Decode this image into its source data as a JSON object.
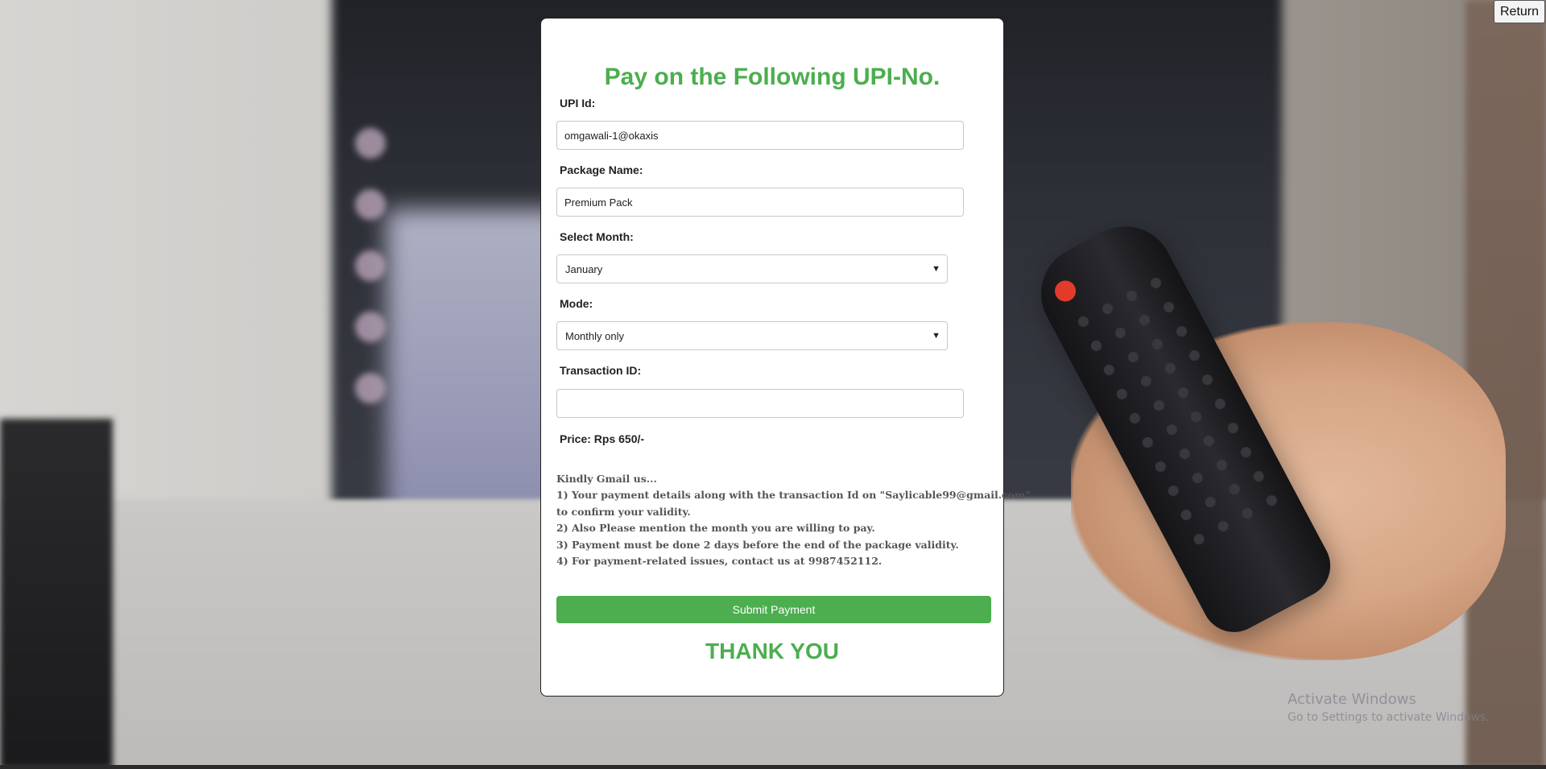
{
  "page": {
    "return_label": "Return"
  },
  "form": {
    "title": "Pay on the Following UPI-No.",
    "upi": {
      "label": "UPI Id:",
      "value": "omgawali-1@okaxis"
    },
    "package": {
      "label": "Package Name:",
      "value": "Premium Pack"
    },
    "month": {
      "label": "Select Month:",
      "selected": "January"
    },
    "mode": {
      "label": "Mode:",
      "selected": "Monthly only"
    },
    "transaction": {
      "label": "Transaction ID:",
      "value": ""
    },
    "price": "Price: Rps 650/-",
    "notes": [
      "Kindly Gmail us...",
      "1) Your payment details along with the transaction Id on \"Saylicable99@gmail.com\"",
      "to confirm your validity.",
      "2) Also Please mention the month you are willing to pay.",
      "3) Payment must be done 2 days before the end of the package validity.",
      "4) For payment-related issues, contact us at 9987452112."
    ],
    "submit_label": "Submit Payment",
    "thanks": "THANK YOU"
  },
  "os": {
    "watermark_title": "Activate Windows",
    "watermark_sub": "Go to Settings to activate Windows."
  },
  "colors": {
    "accent": "#4cae4f"
  },
  "icons": {
    "select_arrow": "chevron-down-icon"
  }
}
